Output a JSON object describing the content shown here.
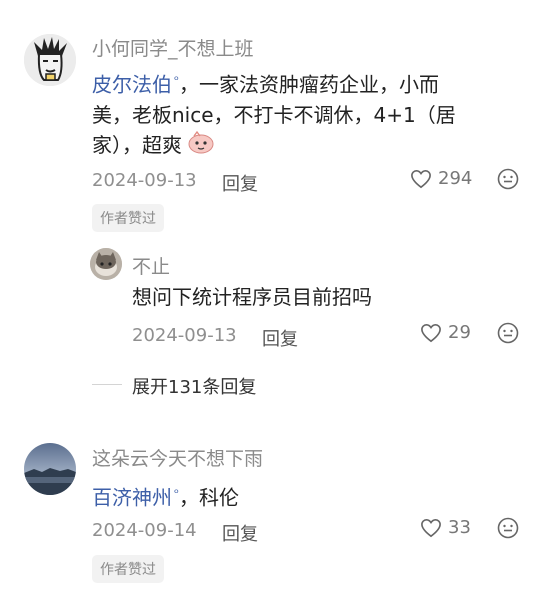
{
  "comments": [
    {
      "username": "小何同学_不想上班",
      "topic": "皮尔法伯",
      "text_line1": "，一家法资肿瘤药企业，小而",
      "text_line2": "美，老板nice，不打卡不调休，4+1（居",
      "text_line3": "家），超爽",
      "date": "2024-09-13",
      "reply_label": "回复",
      "likes": "294",
      "badge": "作者赞过"
    },
    {
      "username": "不止",
      "text": "想问下统计程序员目前招吗",
      "date": "2024-09-13",
      "reply_label": "回复",
      "likes": "29"
    },
    {
      "username": "这朵云今天不想下雨",
      "topic": "百济神州",
      "text_after": "，科伦",
      "date": "2024-09-14",
      "reply_label": "回复",
      "likes": "33",
      "badge": "作者赞过"
    }
  ],
  "expand_label": "展开131条回复",
  "colors": {
    "topic": "#3d5fa8",
    "meta": "#8f8f8f",
    "badge_bg": "#f2f2f2"
  }
}
